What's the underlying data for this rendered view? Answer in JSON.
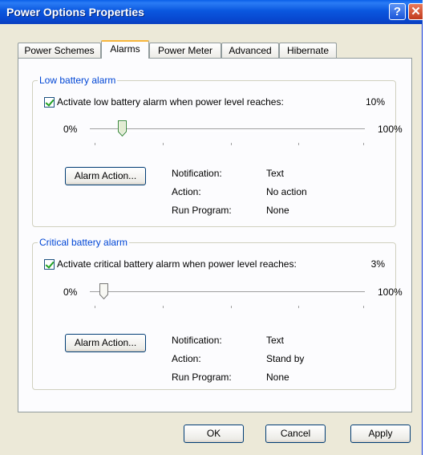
{
  "window": {
    "title": "Power Options Properties",
    "help_glyph": "?",
    "close_glyph": "✕"
  },
  "tabs": [
    {
      "label": "Power Schemes",
      "active": false
    },
    {
      "label": "Alarms",
      "active": true
    },
    {
      "label": "Power Meter",
      "active": false
    },
    {
      "label": "Advanced",
      "active": false
    },
    {
      "label": "Hibernate",
      "active": false
    }
  ],
  "low": {
    "group_label": "Low battery alarm",
    "checkbox_label": "Activate low battery alarm when power level reaches:",
    "checked": true,
    "level": "10%",
    "slider_fraction": 0.1,
    "min_label": "0%",
    "max_label": "100%",
    "alarm_button": "Alarm Action...",
    "notification_label": "Notification:",
    "notification_value": "Text",
    "action_label": "Action:",
    "action_value": "No action",
    "program_label": "Run Program:",
    "program_value": "None"
  },
  "critical": {
    "group_label": "Critical battery alarm",
    "checkbox_label": "Activate critical battery alarm when power level reaches:",
    "checked": true,
    "level": "3%",
    "slider_fraction": 0.03,
    "min_label": "0%",
    "max_label": "100%",
    "alarm_button": "Alarm Action...",
    "notification_label": "Notification:",
    "notification_value": "Text",
    "action_label": "Action:",
    "action_value": "Stand by",
    "program_label": "Run Program:",
    "program_value": "None"
  },
  "buttons": {
    "ok": "OK",
    "cancel": "Cancel",
    "apply": "Apply"
  },
  "colors": {
    "title_bar": "#0a57df",
    "group_label": "#0046d5",
    "tab_highlight": "#f7b63c",
    "check": "#21a121"
  }
}
